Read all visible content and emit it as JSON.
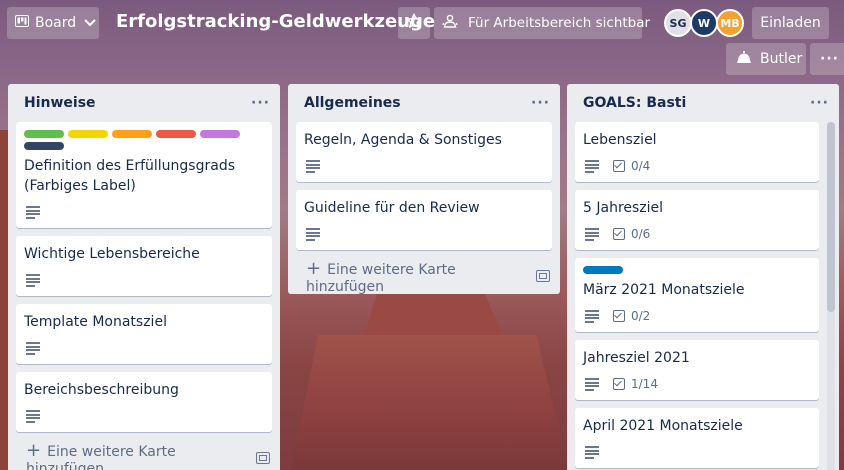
{
  "header": {
    "board_menu_label": "Board",
    "board_title": "Erfolgstracking-Geldwerkzeuge",
    "visibility_label": "Für Arbeitsbereich sichtbar",
    "members": [
      {
        "initials": "SG",
        "color": "#dfe1e6"
      },
      {
        "initials": "W",
        "color": "#1d3b66"
      },
      {
        "initials": "MB",
        "color": "#f4a22d"
      }
    ],
    "invite_label": "Einladen",
    "butler_label": "Butler",
    "more_label": "···"
  },
  "lists": [
    {
      "title": "Hinweise",
      "menu": "···",
      "add_card_label": "Eine weitere Karte hinzufügen",
      "cards": [
        {
          "title": "Definition des Erfüllungsgrads (Farbiges Label)",
          "labels": [
            "#61bd4f",
            "#f2d600",
            "#ff9f1a",
            "#eb5a46",
            "#c377e0",
            "#344563"
          ],
          "has_description": true
        },
        {
          "title": "Wichtige Lebensbereiche",
          "has_description": true
        },
        {
          "title": "Template Monatsziel",
          "has_description": true
        },
        {
          "title": "Bereichsbeschreibung",
          "has_description": true
        }
      ]
    },
    {
      "title": "Allgemeines",
      "menu": "···",
      "add_card_label": "Eine weitere Karte hinzufügen",
      "cards": [
        {
          "title": "Regeln, Agenda & Sonstiges",
          "has_description": true
        },
        {
          "title": "Guideline für den Review",
          "has_description": true
        }
      ]
    },
    {
      "title": "GOALS: Basti",
      "menu": "···",
      "cards": [
        {
          "title": "Lebensziel",
          "has_description": true,
          "checklist": "0/4"
        },
        {
          "title": "5 Jahresziel",
          "has_description": true,
          "checklist": "0/6"
        },
        {
          "title": "März 2021 Monatsziele",
          "labels": [
            "#0079bf"
          ],
          "has_description": true,
          "checklist": "0/2"
        },
        {
          "title": "Jahresziel 2021",
          "has_description": true,
          "checklist": "1/14"
        },
        {
          "title": "April 2021 Monatsziele",
          "has_description": true
        }
      ]
    }
  ]
}
